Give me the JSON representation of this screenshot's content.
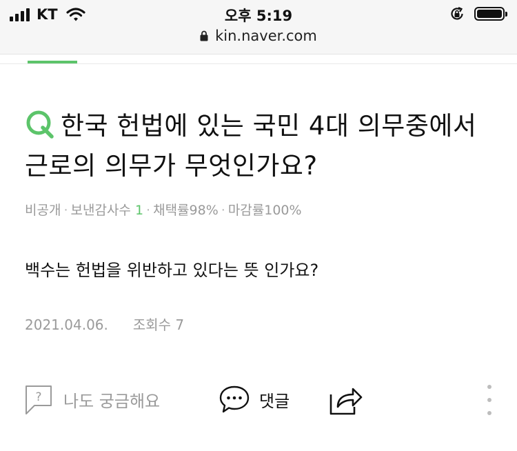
{
  "status_bar": {
    "carrier": "KT",
    "time": "오후 5:19",
    "url": "kin.naver.com"
  },
  "question": {
    "title": "한국 헌법에 있는 국민 4대 의무중에서 근로의 의무가 무엇인가요?",
    "meta": {
      "visibility": "비공개",
      "thanks_label": "보낸감사수",
      "thanks_count": "1",
      "adoption_rate": "채택률98%",
      "closing_rate": "마감률100%"
    },
    "body": "백수는 헌법을 위반하고 있다는 뜻 인가요?",
    "date": "2021.04.06.",
    "views": "조회수 7"
  },
  "actions": {
    "curious_label": "나도 궁금해요",
    "comment_label": "댓글"
  },
  "colors": {
    "accent": "#5cc46a",
    "meta_gray": "#9a9a9a"
  }
}
